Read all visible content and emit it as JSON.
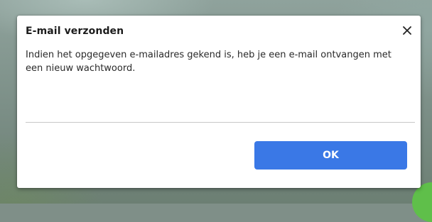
{
  "dialog": {
    "title": "E-mail verzonden",
    "message": "Indien het opgegeven e-mailadres gekend is, heb je een e-mail ontvangen met een nieuw wachtwoord.",
    "close_icon": "close-icon",
    "ok_label": "OK"
  },
  "colors": {
    "primary_button": "#3a78e6",
    "accent_green": "#5fbf4a"
  }
}
